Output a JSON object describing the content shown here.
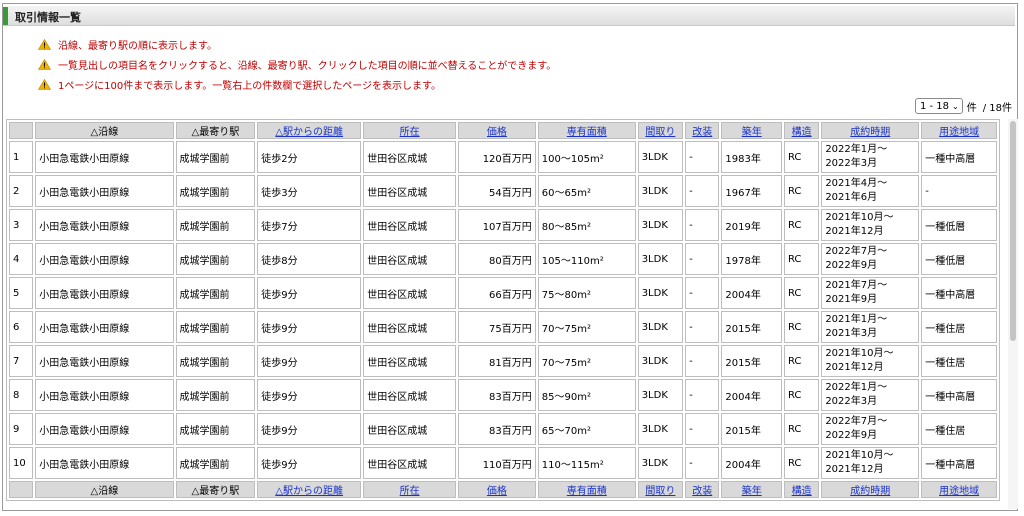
{
  "header": {
    "title": "取引情報一覧"
  },
  "notes": [
    "沿線、最寄り駅の順に表示します。",
    "一覧見出しの項目名をクリックすると、沿線、最寄り駅、クリックした項目の順に並べ替えることができます。",
    "1ページに100件まで表示します。一覧右上の件数欄で選択したページを表示します。"
  ],
  "pager": {
    "selected": "1 - 18",
    "unit": "件",
    "total": "/ 18件"
  },
  "columns": [
    "",
    "△沿線",
    "△最寄り駅",
    "△駅からの距離",
    "所在",
    "価格",
    "専有面積",
    "間取り",
    "改装",
    "築年",
    "構造",
    "成約時期",
    "用途地域"
  ],
  "rows": [
    {
      "no": "1",
      "line": "小田急電鉄小田原線",
      "station": "成城学園前",
      "distance": "徒歩2分",
      "location": "世田谷区成城",
      "price": "120百万円",
      "area": "100～105m²",
      "layout": "3LDK",
      "renovation": "-",
      "year": "1983年",
      "structure": "RC",
      "period1": "2022年1月～",
      "period2": "2022年3月",
      "zone": "一種中高層"
    },
    {
      "no": "2",
      "line": "小田急電鉄小田原線",
      "station": "成城学園前",
      "distance": "徒歩3分",
      "location": "世田谷区成城",
      "price": "54百万円",
      "area": "60～65m²",
      "layout": "3LDK",
      "renovation": "-",
      "year": "1967年",
      "structure": "RC",
      "period1": "2021年4月～",
      "period2": "2021年6月",
      "zone": "-"
    },
    {
      "no": "3",
      "line": "小田急電鉄小田原線",
      "station": "成城学園前",
      "distance": "徒歩7分",
      "location": "世田谷区成城",
      "price": "107百万円",
      "area": "80～85m²",
      "layout": "3LDK",
      "renovation": "-",
      "year": "2019年",
      "structure": "RC",
      "period1": "2021年10月～",
      "period2": "2021年12月",
      "zone": "一種低層"
    },
    {
      "no": "4",
      "line": "小田急電鉄小田原線",
      "station": "成城学園前",
      "distance": "徒歩8分",
      "location": "世田谷区成城",
      "price": "80百万円",
      "area": "105～110m²",
      "layout": "3LDK",
      "renovation": "-",
      "year": "1978年",
      "structure": "RC",
      "period1": "2022年7月～",
      "period2": "2022年9月",
      "zone": "一種低層"
    },
    {
      "no": "5",
      "line": "小田急電鉄小田原線",
      "station": "成城学園前",
      "distance": "徒歩9分",
      "location": "世田谷区成城",
      "price": "66百万円",
      "area": "75～80m²",
      "layout": "3LDK",
      "renovation": "-",
      "year": "2004年",
      "structure": "RC",
      "period1": "2021年7月～",
      "period2": "2021年9月",
      "zone": "一種中高層"
    },
    {
      "no": "6",
      "line": "小田急電鉄小田原線",
      "station": "成城学園前",
      "distance": "徒歩9分",
      "location": "世田谷区成城",
      "price": "75百万円",
      "area": "70～75m²",
      "layout": "3LDK",
      "renovation": "-",
      "year": "2015年",
      "structure": "RC",
      "period1": "2021年1月～",
      "period2": "2021年3月",
      "zone": "一種住居"
    },
    {
      "no": "7",
      "line": "小田急電鉄小田原線",
      "station": "成城学園前",
      "distance": "徒歩9分",
      "location": "世田谷区成城",
      "price": "81百万円",
      "area": "70～75m²",
      "layout": "3LDK",
      "renovation": "-",
      "year": "2015年",
      "structure": "RC",
      "period1": "2021年10月～",
      "period2": "2021年12月",
      "zone": "一種住居"
    },
    {
      "no": "8",
      "line": "小田急電鉄小田原線",
      "station": "成城学園前",
      "distance": "徒歩9分",
      "location": "世田谷区成城",
      "price": "83百万円",
      "area": "85～90m²",
      "layout": "3LDK",
      "renovation": "-",
      "year": "2004年",
      "structure": "RC",
      "period1": "2022年1月～",
      "period2": "2022年3月",
      "zone": "一種中高層"
    },
    {
      "no": "9",
      "line": "小田急電鉄小田原線",
      "station": "成城学園前",
      "distance": "徒歩9分",
      "location": "世田谷区成城",
      "price": "83百万円",
      "area": "65～70m²",
      "layout": "3LDK",
      "renovation": "-",
      "year": "2015年",
      "structure": "RC",
      "period1": "2022年7月～",
      "period2": "2022年9月",
      "zone": "一種住居"
    },
    {
      "no": "10",
      "line": "小田急電鉄小田原線",
      "station": "成城学園前",
      "distance": "徒歩9分",
      "location": "世田谷区成城",
      "price": "110百万円",
      "area": "110～115m²",
      "layout": "3LDK",
      "renovation": "-",
      "year": "2004年",
      "structure": "RC",
      "period1": "2021年10月～",
      "period2": "2021年12月",
      "zone": "一種中高層"
    }
  ],
  "colors": {
    "note_text": "#c00000",
    "link": "#1a33cc",
    "header_bg": "#d9d9d9",
    "accent": "#3a9a3a"
  }
}
